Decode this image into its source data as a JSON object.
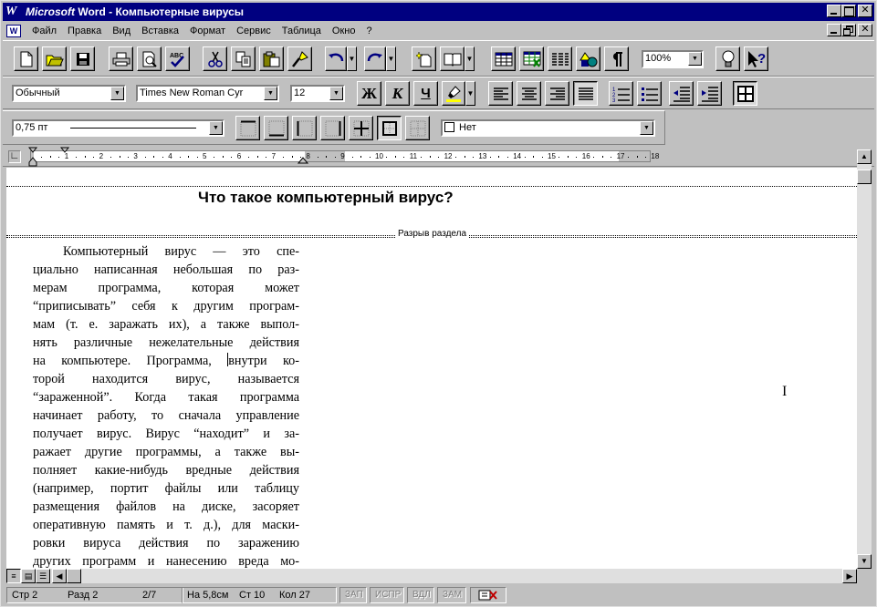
{
  "window": {
    "app_name": "Microsoft",
    "app_word": "Word",
    "doc_title": "- Компьютерные вирусы",
    "logo": "W"
  },
  "menu": {
    "items": [
      "Файл",
      "Правка",
      "Вид",
      "Вставка",
      "Формат",
      "Сервис",
      "Таблица",
      "Окно",
      "?"
    ]
  },
  "toolbar": {
    "zoom": "100%"
  },
  "formatting": {
    "style": "Обычный",
    "font": "Times New Roman Cyr",
    "size": "12",
    "bold_label": "Ж",
    "italic_label": "К",
    "underline_label": "Ч"
  },
  "borders": {
    "line_width": "0,75 пт",
    "shading": "Нет"
  },
  "ruler": {
    "numbers": [
      "1",
      "2",
      "3",
      "4",
      "5",
      "6",
      "7",
      "8",
      "9",
      "10",
      "11",
      "12",
      "13",
      "14",
      "15",
      "16",
      "17",
      "18"
    ]
  },
  "document": {
    "title": "Что такое компьютерный вирус?",
    "section_break": "Разрыв раздела",
    "lines": [
      "Компьютерный вирус — это спе-",
      "циально написанная небольшая по раз-",
      "мерам программа, которая может",
      "“приписывать” себя к другим програм-",
      "мам (т. е. заражать их), а также выпол-",
      "нять различные нежелательные действия",
      "на компьютере. Программа, внутри ко-",
      "торой находится вирус, называется",
      "“зараженной”. Когда такая программа",
      "начинает работу, то сначала управление",
      "получает вирус. Вирус “находит” и за-",
      "ражает другие программы, а также вы-",
      "полняет какие-нибудь вредные действия",
      "(например, портит файлы или таблицу",
      "размещения файлов на диске, засоряет",
      "оперативную память и т. д.), для маски-",
      "ровки вируса действия по заражению",
      "других программ и нанесению вреда мо-"
    ],
    "line7_before_caret": "на компьютере. Программа, ",
    "line7_after_caret": "внутри ко-"
  },
  "status": {
    "page": "Стр 2",
    "section": "Разд 2",
    "pages": "2/7",
    "at": "На 5,8см",
    "line": "Ст 10",
    "col": "Кол 27",
    "rec": "ЗАП",
    "trk": "ИСПР",
    "ext": "ВДЛ",
    "ovr": "ЗАМ"
  }
}
